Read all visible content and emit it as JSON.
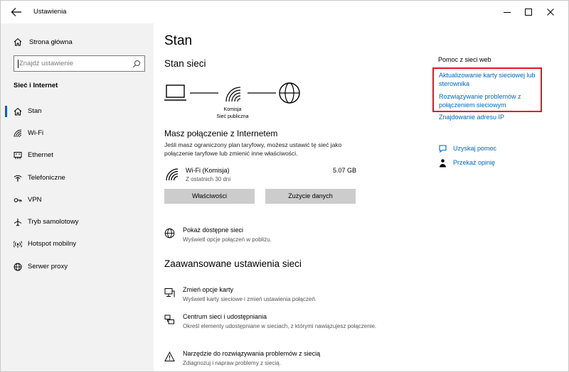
{
  "window": {
    "title": "Ustawienia"
  },
  "sidebar": {
    "home_label": "Strona główna",
    "search_placeholder": "Znajdź ustawienie",
    "section_title": "Sieć i Internet",
    "items": [
      {
        "label": "Stan",
        "icon": "home-icon",
        "active": true
      },
      {
        "label": "Wi-Fi",
        "icon": "wifi-icon"
      },
      {
        "label": "Ethernet",
        "icon": "ethernet-icon"
      },
      {
        "label": "Telefoniczne",
        "icon": "dialup-icon"
      },
      {
        "label": "VPN",
        "icon": "vpn-icon"
      },
      {
        "label": "Tryb samolotowy",
        "icon": "airplane-icon"
      },
      {
        "label": "Hotspot mobilny",
        "icon": "hotspot-icon"
      },
      {
        "label": "Serwer proxy",
        "icon": "globe-icon"
      }
    ]
  },
  "main": {
    "page_title": "Stan",
    "network_status_heading": "Stan sieci",
    "network_name": "Komisja",
    "network_type": "Sieć publiczna",
    "connected_heading": "Masz połączenie z Internetem",
    "connected_desc": "Jeśli masz ograniczony plan taryfowy, możesz ustawić tę sieć jako połączenie taryfowe lub zmienić inne właściwości.",
    "connection": {
      "name": "Wi-Fi (Komisja)",
      "period": "Z ostatnich 30 dni",
      "usage": "5.07 GB"
    },
    "properties_button": "Właściwości",
    "data_usage_button": "Zużycie danych",
    "show_networks": {
      "title": "Pokaż dostępne sieci",
      "desc": "Wyświetl opcje połączeń w pobliżu."
    },
    "advanced_heading": "Zaawansowane ustawienia sieci",
    "advanced_items": [
      {
        "title": "Zmień opcje karty",
        "desc": "Wyświetl karty sieciowe i zmień ustawienia połączeń."
      },
      {
        "title": "Centrum sieci i udostępniania",
        "desc": "Określ elementy udostępniane w sieciach, z którymi nawiązujesz połączenie."
      },
      {
        "title": "Narzędzie do rozwiązywania problemów z siecią",
        "desc": "Zdiagnozuj i napraw problemy z siecią."
      }
    ]
  },
  "right_panel": {
    "title": "Pomoc z sieci web",
    "links": [
      "Aktualizowanie karty sieciowej lub sterownika",
      "Rozwiązywanie problemów z połączeniem sieciowym",
      "Znajdowanie adresu IP"
    ],
    "get_help": "Uzyskaj pomoc",
    "feedback": "Przekaż opinię"
  },
  "colors": {
    "accent": "#0067b8",
    "highlight": "#e81123",
    "sidebar_bg": "#f2f2f2",
    "button_bg": "#cccccc"
  }
}
